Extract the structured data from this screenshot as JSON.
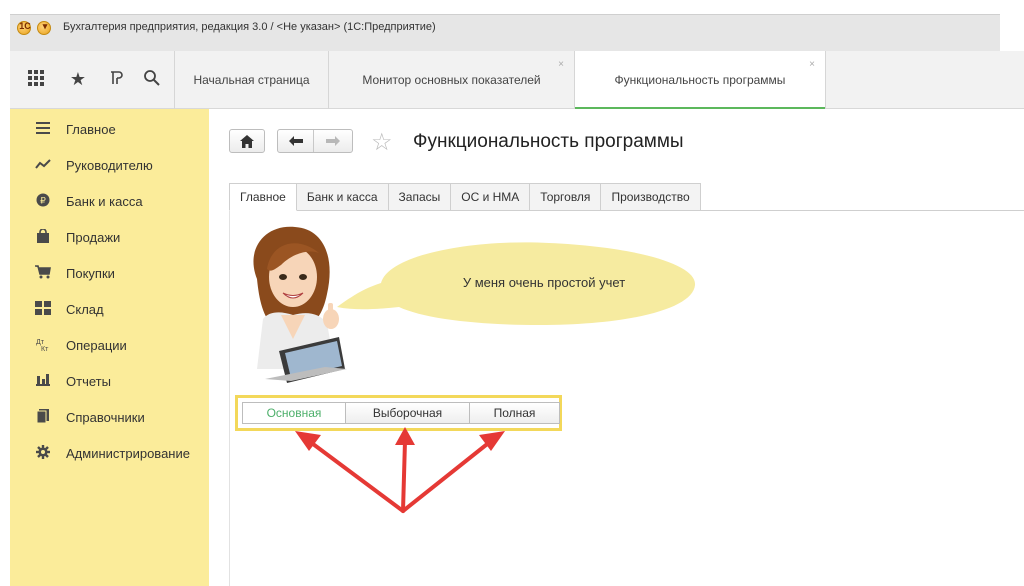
{
  "window": {
    "title": "Бухгалтерия предприятия, редакция 3.0 / <Не указан> (1С:Предприятие)"
  },
  "toolbar": {
    "icons": [
      "apps-grid-icon",
      "favorites-star-icon",
      "history-icon",
      "search-icon"
    ]
  },
  "app_tabs": [
    {
      "label": "Начальная страница"
    },
    {
      "label": "Монитор основных показателей"
    },
    {
      "label": "Функциональность программы"
    }
  ],
  "sidebar": {
    "items": [
      {
        "label": "Главное",
        "icon": "menu-lines-icon"
      },
      {
        "label": "Руководителю",
        "icon": "trend-chart-icon"
      },
      {
        "label": "Банк и касса",
        "icon": "bank-coin-icon"
      },
      {
        "label": "Продажи",
        "icon": "shopping-bag-icon"
      },
      {
        "label": "Покупки",
        "icon": "cart-icon"
      },
      {
        "label": "Склад",
        "icon": "warehouse-icon"
      },
      {
        "label": "Операции",
        "icon": "operations-icon"
      },
      {
        "label": "Отчеты",
        "icon": "bar-chart-icon"
      },
      {
        "label": "Справочники",
        "icon": "book-icon"
      },
      {
        "label": "Администрирование",
        "icon": "gear-icon"
      }
    ]
  },
  "main": {
    "title": "Функциональность программы",
    "tabs": [
      {
        "label": "Главное"
      },
      {
        "label": "Банк и касса"
      },
      {
        "label": "Запасы"
      },
      {
        "label": "ОС и НМА"
      },
      {
        "label": "Торговля"
      },
      {
        "label": "Производство"
      }
    ],
    "bubble_text": "У меня очень простой учет",
    "modes": [
      {
        "label": "Основная"
      },
      {
        "label": "Выборочная"
      },
      {
        "label": "Полная"
      }
    ]
  },
  "colors": {
    "sidebar_bg": "#fbec9a",
    "active_tab_accent": "#5cb85c",
    "mode_box_border": "#f3d85a",
    "selected_mode_text": "#4caf6a",
    "annotation_arrows": "#e53935",
    "bubble_fill": "#f6eba0"
  }
}
